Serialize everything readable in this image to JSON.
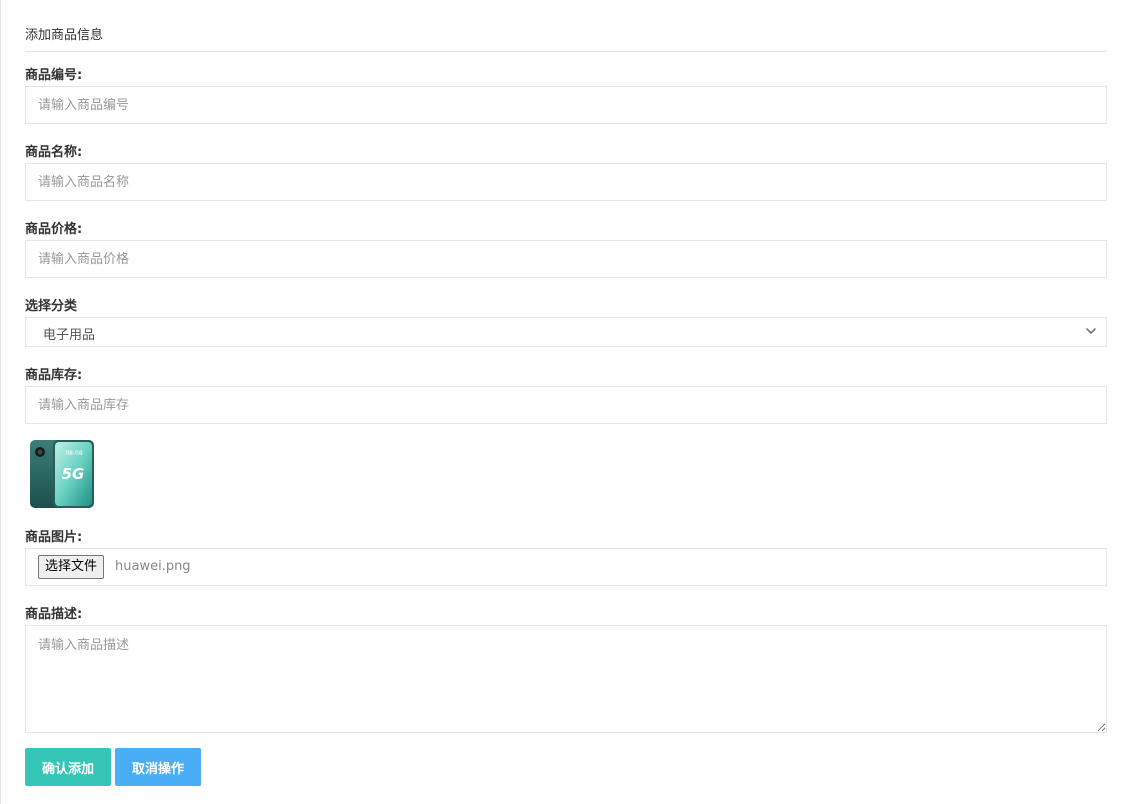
{
  "panel": {
    "title": "添加商品信息"
  },
  "form": {
    "code": {
      "label": "商品编号:",
      "placeholder": "请输入商品编号"
    },
    "name": {
      "label": "商品名称:",
      "placeholder": "请输入商品名称"
    },
    "price": {
      "label": "商品价格:",
      "placeholder": "请输入商品价格"
    },
    "category": {
      "label": "选择分类",
      "selected": "电子用品"
    },
    "stock": {
      "label": "商品库存:",
      "placeholder": "请输入商品库存"
    },
    "image": {
      "label": "商品图片:",
      "choose_button": "选择文件",
      "file_name": "huawei.png",
      "preview_text": "5G"
    },
    "description": {
      "label": "商品描述:",
      "placeholder": "请输入商品描述"
    }
  },
  "actions": {
    "confirm": "确认添加",
    "cancel": "取消操作"
  },
  "colors": {
    "confirm": "#35c6b8",
    "cancel": "#49aef5",
    "border": "#e6e6e6"
  }
}
